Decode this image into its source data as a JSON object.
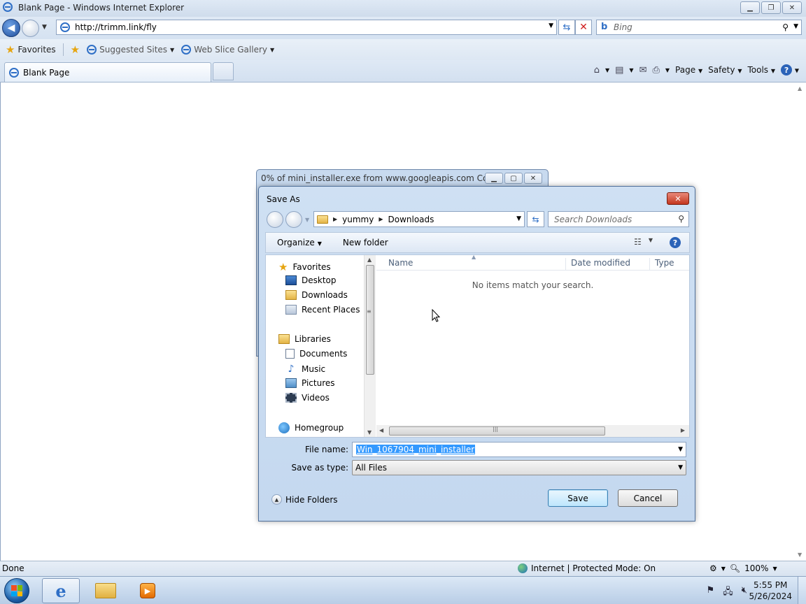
{
  "browser": {
    "window_title": "Blank Page - Windows Internet Explorer",
    "address": "http://trimm.link/fly",
    "search_placeholder": "Bing",
    "favorites_label": "Favorites",
    "suggested_sites": "Suggested Sites",
    "web_slice_gallery": "Web Slice Gallery",
    "tab_title": "Blank Page",
    "commands": {
      "page": "Page",
      "safety": "Safety",
      "tools": "Tools"
    },
    "status_done": "Done",
    "zone": "Internet | Protected Mode: On",
    "zoom": "100%"
  },
  "download_dialog": {
    "title": "0% of mini_installer.exe from www.googleapis.com Co..."
  },
  "save_as": {
    "title": "Save As",
    "breadcrumb": [
      "yummy",
      "Downloads"
    ],
    "search_placeholder": "Search Downloads",
    "toolbar": {
      "organize": "Organize",
      "new_folder": "New folder"
    },
    "nav": {
      "favorites": "Favorites",
      "favorites_items": [
        "Desktop",
        "Downloads",
        "Recent Places"
      ],
      "libraries": "Libraries",
      "libraries_items": [
        "Documents",
        "Music",
        "Pictures",
        "Videos"
      ],
      "homegroup": "Homegroup"
    },
    "columns": [
      "Name",
      "Date modified",
      "Type"
    ],
    "empty_message": "No items match your search.",
    "file_name_label": "File name:",
    "file_name_value": "Win_1067904_mini_installer",
    "save_type_label": "Save as type:",
    "save_type_value": "All Files",
    "hide_folders": "Hide Folders",
    "save_button": "Save",
    "cancel_button": "Cancel"
  },
  "taskbar": {
    "time": "5:55 PM",
    "date": "5/26/2024"
  }
}
